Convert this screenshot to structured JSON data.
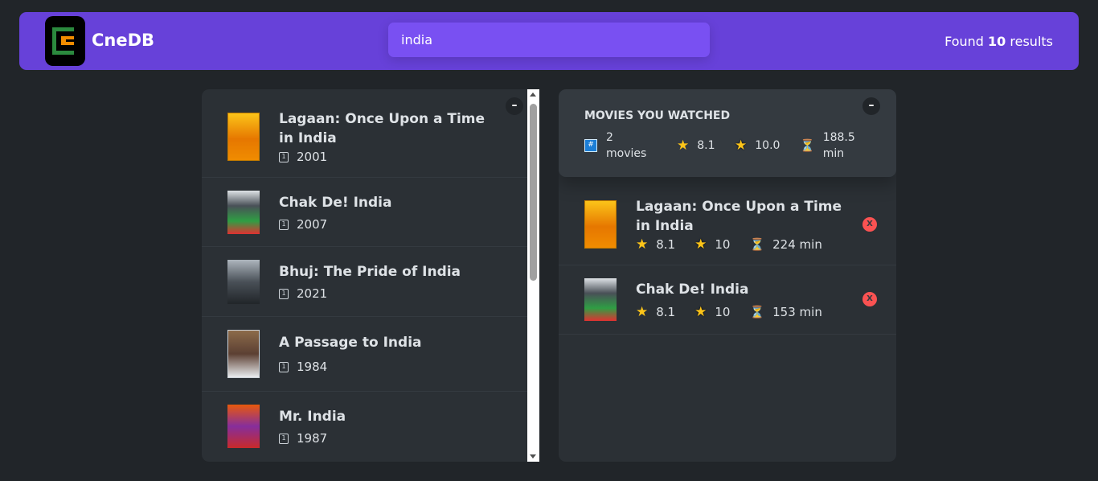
{
  "header": {
    "brand": "CneDB",
    "search_value": "india",
    "found_prefix": "Found",
    "found_count": "10",
    "found_suffix": "results"
  },
  "toggle_label": "–",
  "results": [
    {
      "title": "Lagaan: Once Upon a Time in India",
      "year": "2001"
    },
    {
      "title": "Chak De! India",
      "year": "2007"
    },
    {
      "title": "Bhuj: The Pride of India",
      "year": "2021"
    },
    {
      "title": "A Passage to India",
      "year": "1984"
    },
    {
      "title": "Mr. India",
      "year": "1987"
    }
  ],
  "summary": {
    "title": "MOVIES YOU WATCHED",
    "count_line1": "2",
    "count_line2": "movies",
    "avg_imdb": "8.1",
    "avg_user": "10.0",
    "runtime_line1": "188.5",
    "runtime_line2": "min"
  },
  "watched": [
    {
      "title": "Lagaan: Once Upon a Time in India",
      "imdb": "8.1",
      "user": "10",
      "runtime": "224 min"
    },
    {
      "title": "Chak De! India",
      "imdb": "8.1",
      "user": "10",
      "runtime": "153 min"
    }
  ],
  "delete_label": "X",
  "icons": {
    "calendar": "🗓",
    "hash": "#",
    "star": "★",
    "hourglass": "⏳"
  }
}
